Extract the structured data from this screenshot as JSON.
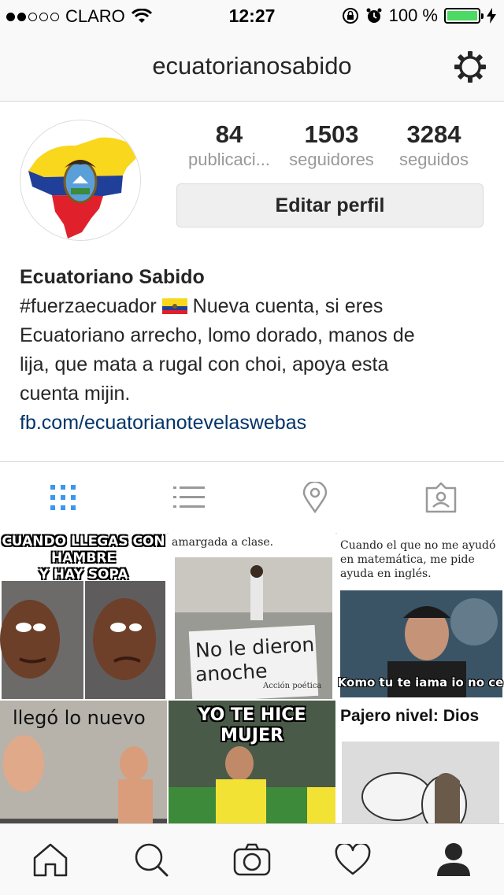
{
  "status_bar": {
    "carrier": "CLARO",
    "time": "12:27",
    "battery_percent": "100 %",
    "battery_level": 1.0
  },
  "nav": {
    "title": "ecuatorianosabido",
    "settings_icon": "gear-icon"
  },
  "profile": {
    "stats": [
      {
        "number": "84",
        "label": "publicaci..."
      },
      {
        "number": "1503",
        "label": "seguidores"
      },
      {
        "number": "3284",
        "label": "seguidos"
      }
    ],
    "edit_button": "Editar perfil",
    "name": "Ecuatoriano Sabido",
    "bio_hashtag": "#fuerzaecuador",
    "bio_line1_rest": " Nueva cuenta, si eres",
    "bio_line2": "Ecuatoriano arrecho, lomo dorado, manos de",
    "bio_line3": "lija, que mata a rugal con choi, apoya esta",
    "bio_line4": "cuenta mijin.",
    "link": "fb.com/ecuatorianotevelaswebas"
  },
  "tabs": [
    "grid-icon",
    "list-icon",
    "location-pin-icon",
    "tagged-icon"
  ],
  "posts": [
    {
      "caption_top": "CUANDO LLEGAS CON HAMBRE",
      "caption_top2": "Y HAY SOPA"
    },
    {
      "caption": "amargada a clase.",
      "sign_line1": "No le dieron",
      "sign_line2": "anoche",
      "sign_small": "Acción poética"
    },
    {
      "caption": "Cuando el que no me ayudó en matemática, me pide ayuda en inglés.",
      "bottom": "Komo tu te iama io no ce"
    },
    {
      "caption": "llegó lo nuevo"
    },
    {
      "caption_top": "YO TE HICE MUJER"
    },
    {
      "caption": "Pajero nivel: Dios"
    }
  ],
  "tabbar": [
    "home-icon",
    "search-icon",
    "camera-icon",
    "heart-icon",
    "profile-icon"
  ]
}
